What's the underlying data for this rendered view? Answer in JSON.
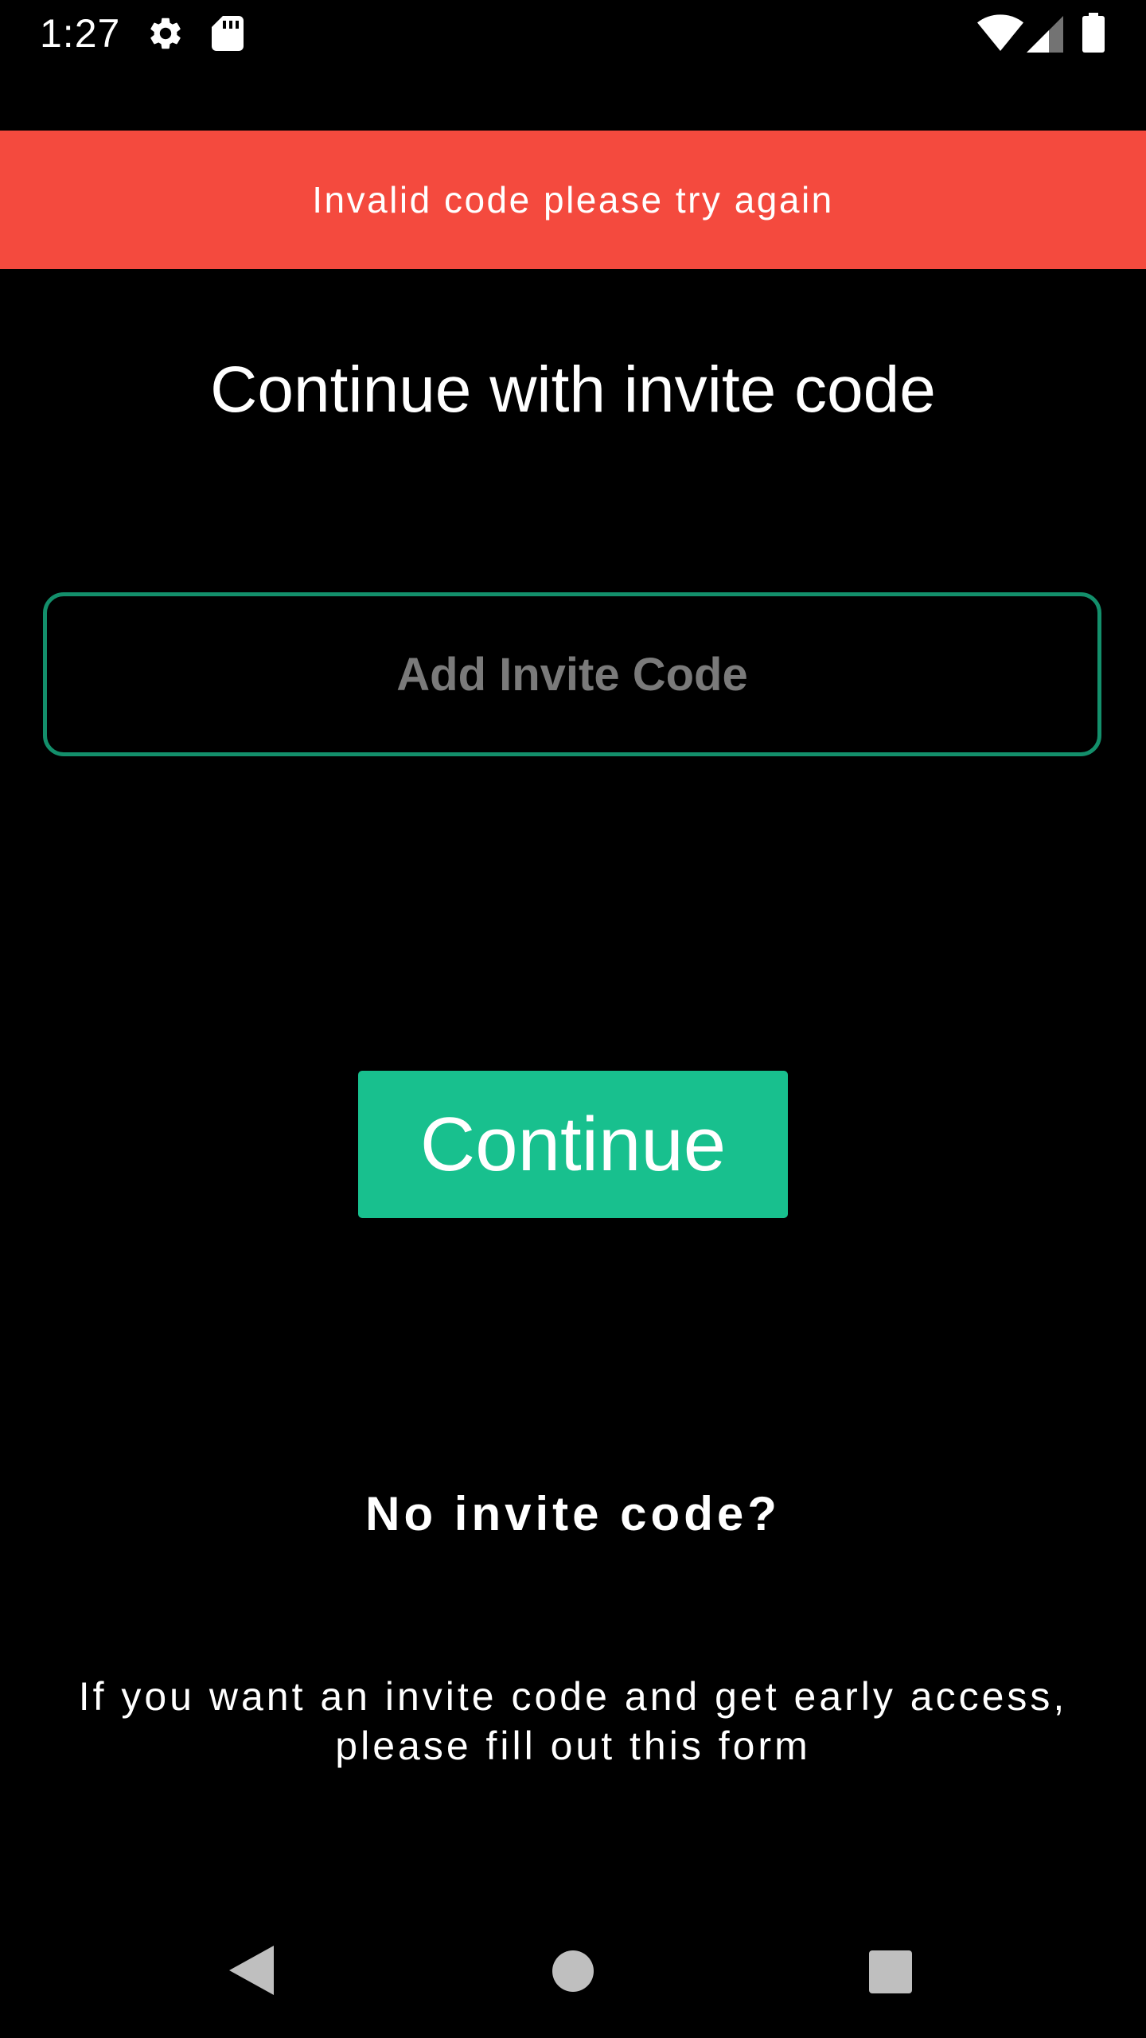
{
  "status_bar": {
    "time": "1:27",
    "icons": [
      "gear-icon",
      "sd-card-icon",
      "wifi-icon",
      "cell-signal-icon",
      "battery-icon"
    ]
  },
  "banner": {
    "error_message": "Invalid code please try again",
    "color": "#F44A3E"
  },
  "main": {
    "title": "Continue with invite code",
    "invite_input": {
      "value": "",
      "placeholder": "Add Invite Code",
      "border_color": "#138F6B"
    },
    "continue_label": "Continue",
    "continue_color": "#18C08E",
    "no_code_heading": "No invite code?",
    "form_text": "If you want an invite code and get early access, please fill out this form"
  },
  "nav_bar": {
    "icons": [
      "back-icon",
      "home-icon",
      "recents-icon"
    ]
  }
}
